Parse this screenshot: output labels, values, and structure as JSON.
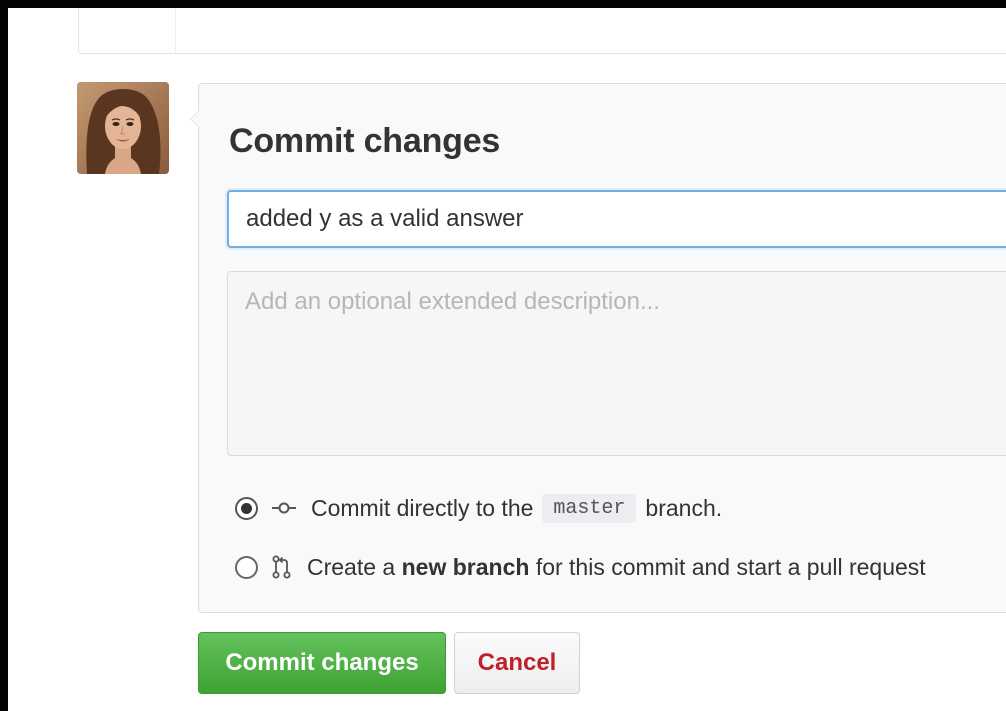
{
  "commit_form": {
    "title": "Commit changes",
    "summary_value": "added y as a valid answer",
    "description_placeholder": "Add an optional extended description...",
    "options": {
      "direct": {
        "prefix": "Commit directly to the",
        "branch": "master",
        "suffix": "branch.",
        "checked": true
      },
      "new_branch": {
        "prefix": "Create a",
        "strong": "new branch",
        "suffix": "for this commit and start a pull request",
        "checked": false
      }
    },
    "buttons": {
      "commit_label": "Commit changes",
      "cancel_label": "Cancel"
    }
  },
  "colors": {
    "commit_button": "#4cae42",
    "cancel_text": "#c0202a",
    "focus_border": "#6fb0e6"
  },
  "icons": {
    "commit_option": "git-commit-icon",
    "branch_option": "git-pull-request-icon",
    "avatar": "user-avatar"
  }
}
